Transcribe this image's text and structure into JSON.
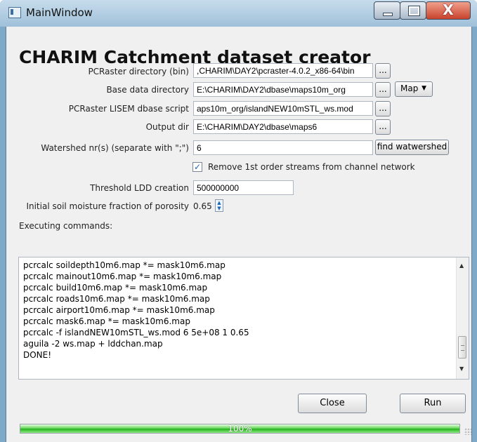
{
  "window": {
    "title": "MainWindow",
    "controls": {
      "minimize": "minimize",
      "maximize": "maximize",
      "close": "X"
    }
  },
  "app": {
    "heading": "CHARIM Catchment dataset creator"
  },
  "form": {
    "pcraster_dir_label": "PCRaster directory (bin)",
    "pcraster_dir_value": ",CHARIM\\DAY2\\pcraster-4.0.2_x86-64\\bin",
    "base_data_label": "Base data directory",
    "base_data_value": "E:\\CHARIM\\DAY2\\dbase\\maps10m_org",
    "lisem_script_label": "PCRaster LISEM dbase script",
    "lisem_script_value": "aps10m_org/islandNEW10mSTL_ws.mod",
    "output_dir_label": "Output dir",
    "output_dir_value": "E:\\CHARIM\\DAY2\\dbase\\maps6",
    "watershed_label": "Watershed nr(s) (separate with \";\")",
    "watershed_value": "6",
    "find_watershed_label": "find watwershed",
    "remove_streams_label": "Remove 1st order streams from channel network",
    "remove_streams_checked": true,
    "threshold_label": "Threshold LDD creation",
    "threshold_value": "500000000",
    "moisture_label": "Initial soil moisture fraction of porosity",
    "moisture_value": "0.65",
    "browse_label": "...",
    "map_label": "Map",
    "map_dropdown_icon": "triangle-down"
  },
  "execution": {
    "label": "Executing commands:",
    "lines": [
      "pcrcalc soildepth10m6.map *= mask10m6.map",
      "pcrcalc mainout10m6.map *= mask10m6.map",
      "pcrcalc build10m6.map *= mask10m6.map",
      "pcrcalc roads10m6.map *= mask10m6.map",
      "pcrcalc airport10m6.map *= mask10m6.map",
      "pcrcalc mask6.map *= mask10m6.map",
      "pcrcalc -f islandNEW10mSTL_ws.mod 6 5e+08 1 0.65",
      "aguila -2 ws.map + lddchan.map",
      "DONE!"
    ]
  },
  "actions": {
    "close": "Close",
    "run": "Run"
  },
  "progress": {
    "value": 1.0,
    "text": "100%"
  },
  "colors": {
    "accent": "#2ca420",
    "title_bar": "#9fc0d9",
    "close_button": "#c8432c"
  }
}
